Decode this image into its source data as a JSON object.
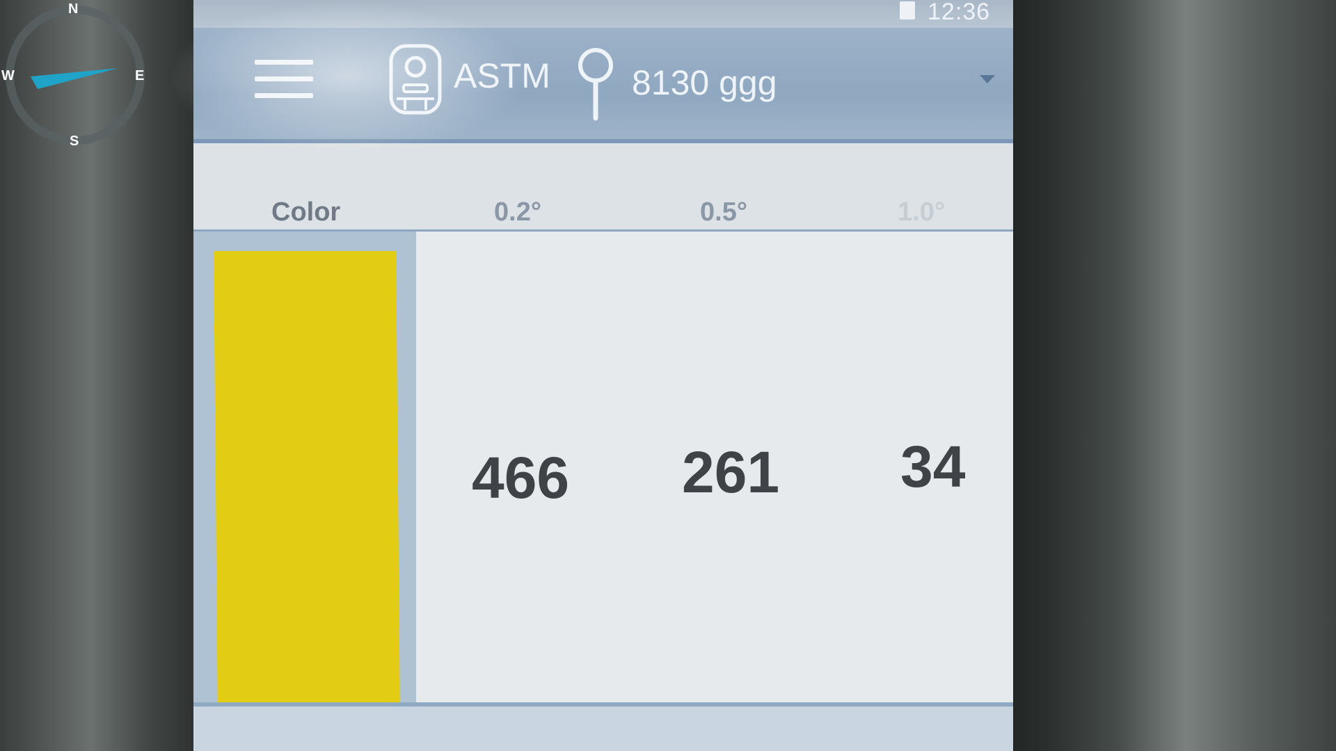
{
  "status_bar": {
    "clock": "12:36"
  },
  "app_bar": {
    "menu_icon": "menu-icon",
    "device_icon": "retroreflectometer-icon",
    "standard_label": "ASTM",
    "location_icon": "map-pin-icon",
    "location_name": "8130 ggg"
  },
  "table": {
    "headers": [
      "Color",
      "0.2°",
      "0.5°",
      "1.0°"
    ],
    "row": {
      "color_swatch": "#E2CC14",
      "values": [
        "466",
        "261",
        "34"
      ]
    }
  },
  "compass": {
    "labels": {
      "n": "N",
      "s": "S",
      "w": "W",
      "e": "E"
    },
    "needle_color": "#1FA3C9"
  }
}
